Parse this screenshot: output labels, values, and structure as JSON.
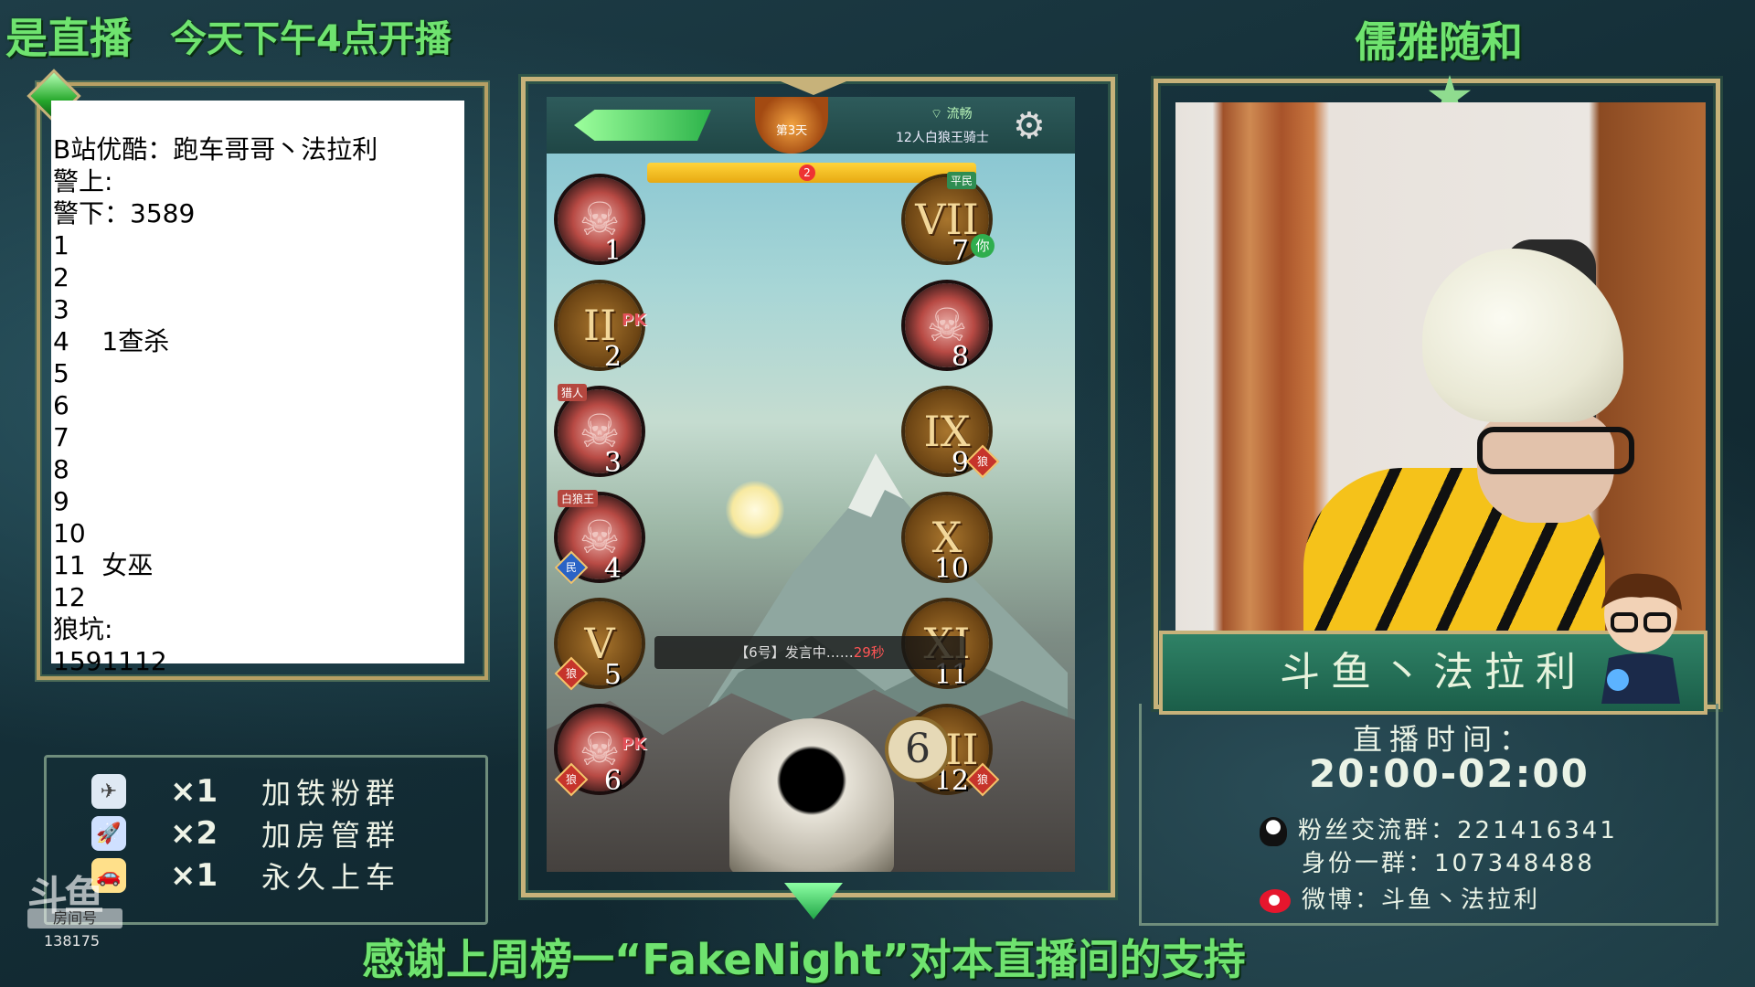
{
  "header": {
    "left_title": "是直播",
    "schedule": "今天下午4点开播",
    "right_title": "儒雅随和"
  },
  "notes": {
    "lines": [
      "B站优酷：跑车哥哥丶法拉利",
      "警上:",
      "警下：3589",
      "1",
      "2",
      "3",
      "4    1查杀",
      "5",
      "6",
      "7",
      "8",
      "9",
      "10",
      "11  女巫",
      "12",
      "狼坑:",
      "1591112"
    ]
  },
  "gifts": [
    {
      "icon": "airplane-icon",
      "mult": "×1",
      "label": "加铁粉群"
    },
    {
      "icon": "rocket-icon",
      "mult": "×2",
      "label": "加房管群"
    },
    {
      "icon": "car-icon",
      "mult": "×1",
      "label": "永久上车"
    }
  ],
  "douyu": {
    "logo": "斗鱼",
    "room_tag": "房间号",
    "room_num": "138175"
  },
  "game": {
    "day": "第3天",
    "net_status": "流畅",
    "mode": "12人白狼王骑士",
    "progress_marker": "2",
    "speech_prefix": "【6号】发言中……",
    "speech_seconds": "29秒",
    "current_speaker": "6",
    "seats": [
      {
        "num": "1",
        "state": "dead"
      },
      {
        "num": "2",
        "roman": "II",
        "pk": "PK"
      },
      {
        "num": "3",
        "state": "dead",
        "tag": "猎人"
      },
      {
        "num": "4",
        "state": "dead",
        "tag": "白狼王",
        "badge": "民"
      },
      {
        "num": "5",
        "roman": "V",
        "badge": "狼"
      },
      {
        "num": "6",
        "state": "dead",
        "pk": "PK",
        "badge": "狼"
      },
      {
        "num": "7",
        "roman": "VII",
        "tag": "平民",
        "you": "你"
      },
      {
        "num": "8",
        "state": "dead"
      },
      {
        "num": "9",
        "roman": "IX",
        "badge": "狼"
      },
      {
        "num": "10",
        "roman": "X"
      },
      {
        "num": "11",
        "roman": "XI"
      },
      {
        "num": "12",
        "roman": "XII",
        "badge": "狼"
      }
    ]
  },
  "streamer": {
    "banner": "斗鱼丶法拉利",
    "time_label": "直播时间：",
    "time": "20:00-02:00",
    "fan_group": "粉丝交流群：221416341",
    "id_group": "身份一群：107348488",
    "weibo": "微博：斗鱼丶法拉利"
  },
  "footer": {
    "thanks": "感谢上周榜一“FakeNight”对本直播间的支持"
  },
  "colors": {
    "title_green": "#6fe36f",
    "gold": "#c7b27a",
    "panel_green": "#2f8266"
  }
}
